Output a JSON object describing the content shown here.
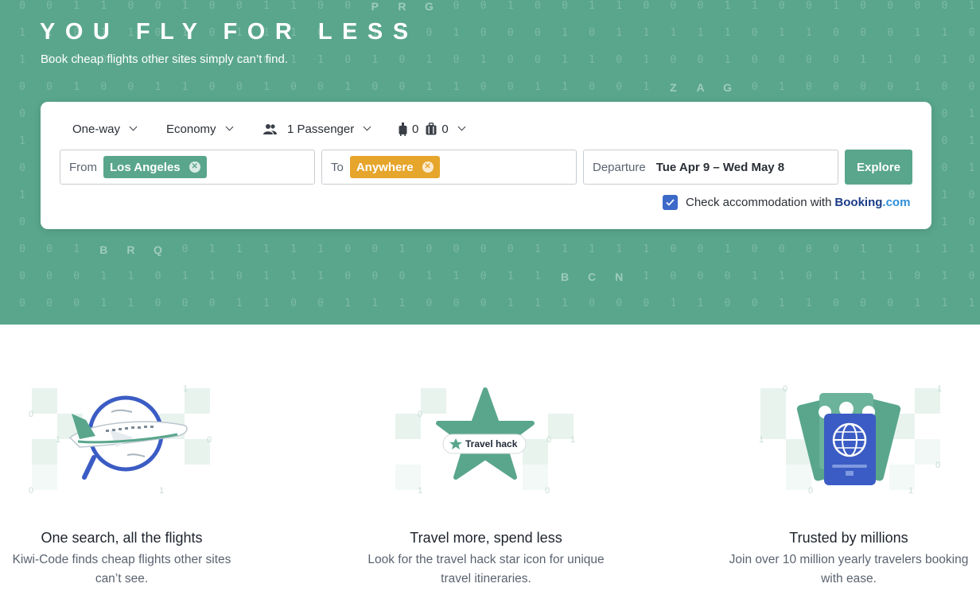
{
  "hero": {
    "title": "YOU FLY FOR LESS",
    "subtitle": "Book cheap flights other sites simply can’t find.",
    "background_color": "#59a68c",
    "binary_rows": [
      "0 0 1 1 0 0 1 0 0 1 1 0 0 P R G 0 0 1 0 0 1 1 0 0 0 1 1 0 0 1 0 0 0 0 1 1 0 0 0 0 0 1 1 0 1 0 1 0 1 0 0 0 1 0 1 0 1 0 1 1 0 1 0",
      "1 1 0 1 1 0 1 0 1 1 1 0 0 1 0 0 1 0 0 0 1 0 1 1 1 1 1 0 1 1 0 0 0 1 1 0 1 0 0 1 1 1 1 0 1 0 1 0 1 0 0 1 0 1 1 0 1 1 0 1 1 1 0 1",
      "1 0 1 0 1 1 0 1 1 0 1 1 0 1 0 1 0 1 0 0 1 1 0 1 0 0 1 0 0 0 0 1 1 0 1 0 0 0 1 0 0 0 1 0 1 1 0 1 0 1 1 0 0 0 1 0 0 1 0 0 1 0 0 1",
      "0 0 1 0 0 1 1 0 0 1 0 0 1 0 0 1 1 0 0 1 1 0 0 1 Z A G 0 1 0 0 0 0 1 0 0 1 0 1 0 1 0 0 1 1 0 0 0 0 1 1 1 1 0 1 0 0 1 0 1 0 1",
      "0 0 1 0 1 0 0 1 1 0 1 1 0 1 1 0 1 0 0 1 0 0 1 1 0 1 0 0 0 1 0 1 0 1 0 1 1 0 1 0 1 0 0 1 1 0 1 0 1 1 0 1 0 0 1 1 0 1 0 0 1 1 0 1",
      "1 0 1 1 0 0 1 0 1 0 0 1 1 0 1 0 1 1 0 1 0 1 0 1 1 0 1 0 0 1 1 0 0 1 0 1 0 1 1 0 1 0 1 0 1 1 0 0 1 0 1 0 1 1 0 1 0 1 0 1 0 1 1 0",
      "0 0 0 1 1 0 1 1 0 0 1 0 1 0 1 0 1 0 1 1 0 1 0 1 0 0 1 0 1 0 1 1 0 1 0 1 0 0 1 0 1 1 0 1 0 0 1 0 1 0 0 1 1 0 1 0 1 0 0 1 0 1 0 1",
      "1 1 0 0 1 0 1 0 0 1 1 0 1 0 0 1 0 1 1 0 0 1 0 1 1 0 1 0 0 1 0 1 0 1 1 0 1 0 0 1 0 1 0 1 1 0 0 1 0 1 0 1 0 0 1 0 1 1 0 0 1 1 0 1",
      "0 1 0 1 0 0 1 1 0 1 0 1 0 1 1 0 0 1 0 1 0 0 1 0 1 1 0 1 0 1 0 0 1 0 1 0 1 1 0 1 0 0 1 0 1 1 0 1 0 0 1 0 1 0 1 1 0 1 0 1 0 0 1 1",
      "0 0 1 B R Q 0 1 1 1 1 1 0 0 1 0 0 0 0 1 1 1 1 1 0 0 1 0 0 0 0 1 1 1 1 1 0 0 1 0 0 0 0 1 1 1 1 0 0 1 0 1 0 1 1 0 0 1 0 1 0 1 0 1",
      "0 0 0 1 1 0 1 1 0 1 1 1 0 0 0 1 1 0 1 1 B C N 1 0 0 0 1 1 0 1 1 1 0 1 0 0 1 0 1 1 0 1 1 0 0 1 0 1 0 1 1 0 0 1 1 0 1 0 1 0 1 1 0",
      "0 0 0 1 1 0 0 0 1 1 0 0 1 1 1 0 0 0 1 1 1 0 0 0 1 1 0 0 1 1 0 0 0 1 1 1 0 0 0 1 0 1 0 1 1 0 1 0 1 0 0 1 1 0 1 0 1 0 1 1 0 1 0 1"
    ]
  },
  "search": {
    "trip_type": "One-way",
    "cabin_class": "Economy",
    "passengers": "1 Passenger",
    "cabin_bags": "0",
    "checked_bags": "0",
    "from_label": "From",
    "from_value": "Los Angeles",
    "to_label": "To",
    "to_value": "Anywhere",
    "departure_label": "Departure",
    "departure_value": "Tue Apr 9 – Wed May 8",
    "explore_label": "Explore",
    "accommodation_text": "Check accommodation with",
    "accommodation_checked": true,
    "booking_brand": "Booking",
    "booking_tld": ".com",
    "colors": {
      "from_chip": "#59a68c",
      "to_chip": "#e6a52b",
      "explore": "#59a68c",
      "checkbox": "#3d69c8"
    }
  },
  "features": [
    {
      "title": "One search, all the flights",
      "desc_line1": "Kiwi-Code finds cheap flights other sites",
      "desc_line2": "can’t see.",
      "icon": "airplane-magnifier-icon"
    },
    {
      "title": "Travel more, spend less",
      "desc_line1": "Look for the travel hack star icon for unique",
      "desc_line2": "travel itineraries.",
      "icon": "star-icon",
      "badge": "Travel hack"
    },
    {
      "title": "Trusted by millions",
      "desc_line1": "Join over 10 million yearly travelers booking",
      "desc_line2": "with ease.",
      "icon": "passport-icon"
    }
  ]
}
